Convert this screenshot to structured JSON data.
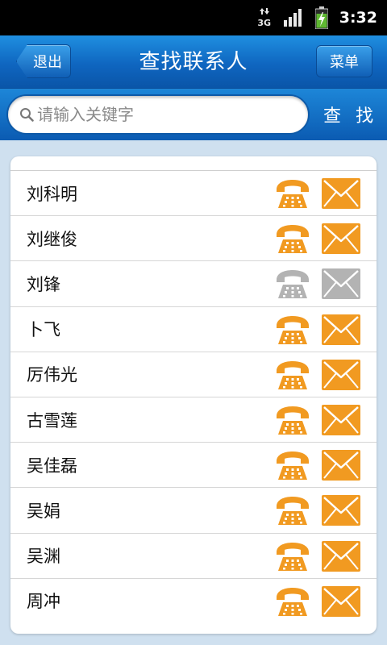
{
  "status_bar": {
    "network": "3G",
    "time": "3:32"
  },
  "header": {
    "back_label": "退出",
    "title": "查找联系人",
    "menu_label": "菜单"
  },
  "search": {
    "placeholder": "请输入关键字",
    "button_label": "查 找"
  },
  "colors": {
    "icon_active": "#f19a21",
    "icon_disabled": "#b3b3b3",
    "header_blue": "#0f66c0"
  },
  "contacts": [
    {
      "name": "刘科明",
      "enabled": true
    },
    {
      "name": "刘继俊",
      "enabled": true
    },
    {
      "name": "刘锋",
      "enabled": false
    },
    {
      "name": "卜飞",
      "enabled": true
    },
    {
      "name": "厉伟光",
      "enabled": true
    },
    {
      "name": "古雪莲",
      "enabled": true
    },
    {
      "name": "吴佳磊",
      "enabled": true
    },
    {
      "name": "吴娟",
      "enabled": true
    },
    {
      "name": "吴渊",
      "enabled": true
    },
    {
      "name": "周冲",
      "enabled": true
    }
  ]
}
